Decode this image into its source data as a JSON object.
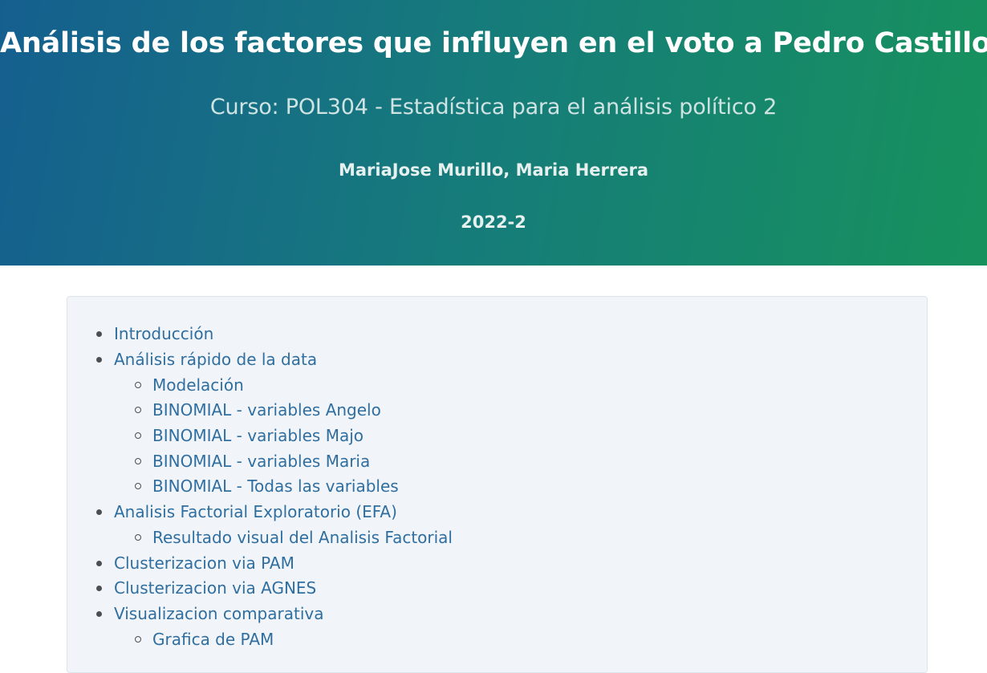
{
  "header": {
    "title": "Análisis de los factores que influyen en el voto a Pedro Castillo",
    "subtitle": "Curso: POL304 - Estadística para el análisis político 2",
    "authors": "MariaJose Murillo, Maria Herrera",
    "date": "2022-2"
  },
  "toc": {
    "items": [
      {
        "label": "Introducción",
        "level": 1
      },
      {
        "label": "Análisis rápido de la data",
        "level": 1
      },
      {
        "label": "Modelación",
        "level": 2
      },
      {
        "label": "BINOMIAL - variables Angelo",
        "level": 2
      },
      {
        "label": "BINOMIAL - variables Majo",
        "level": 2
      },
      {
        "label": "BINOMIAL - variables Maria",
        "level": 2
      },
      {
        "label": "BINOMIAL - Todas las variables",
        "level": 2
      },
      {
        "label": "Analisis Factorial Exploratorio (EFA)",
        "level": 1
      },
      {
        "label": "Resultado visual del Analisis Factorial",
        "level": 2
      },
      {
        "label": "Clusterizacion via PAM",
        "level": 1
      },
      {
        "label": "Clusterizacion via AGNES",
        "level": 1
      },
      {
        "label": "Visualizacion comparativa",
        "level": 1
      },
      {
        "label": "Grafica de PAM",
        "level": 2
      }
    ]
  },
  "colors": {
    "link": "#2f6e9e",
    "toc_background": "#f1f5fa",
    "header_gradient_start": "#155f8f",
    "header_gradient_end": "#17925d"
  }
}
